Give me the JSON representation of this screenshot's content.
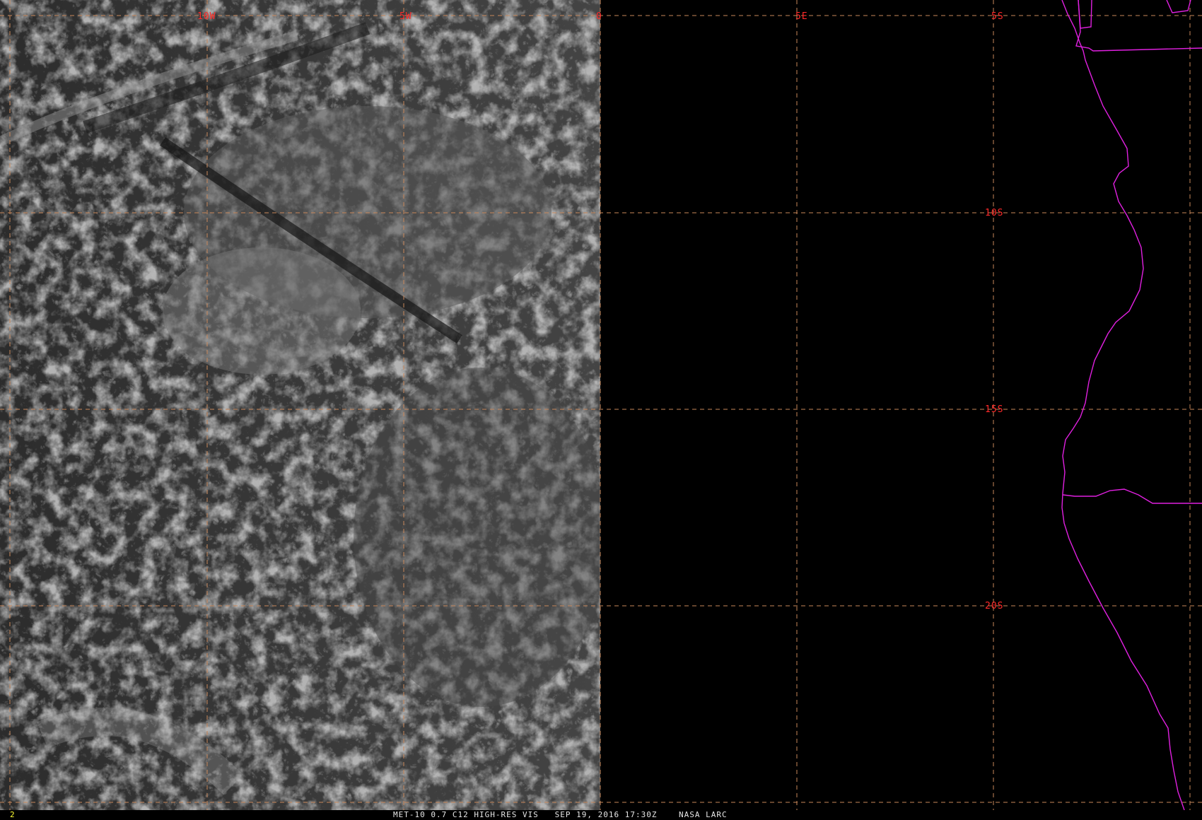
{
  "map": {
    "colors": {
      "graticule": "#c8875a",
      "graticule_label": "#ff2a2a",
      "coastline": "#e020e0",
      "cloud_light": "#8a8a8a",
      "cloud_dark": "#1a1a1a",
      "night_side": "#000000"
    },
    "graticule": {
      "longitude_labels": [
        "10W",
        "5W",
        "0",
        "5E",
        "5S"
      ],
      "latitude_labels": [
        "10S",
        "15S",
        "20S"
      ]
    },
    "regions": {
      "cloud_field": "satellite-visible-imagery",
      "dark_field": "night-side",
      "land": "southwest-africa-coast"
    }
  },
  "status": {
    "frame_number": "2",
    "caption": "MET-10 0.7 C12 HIGH-RES VIS   SEP 19, 2016 17:30Z    NASA LARC"
  }
}
